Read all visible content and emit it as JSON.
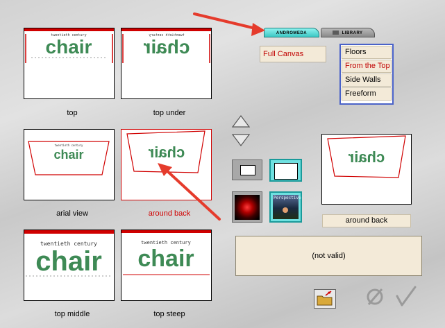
{
  "tabs": [
    {
      "label": "ANDROMEDA",
      "active": true
    },
    {
      "label": "LIBRARY",
      "active": false
    }
  ],
  "mode_field": {
    "value": "Full Canvas"
  },
  "view_list": {
    "items": [
      "Floors",
      "From the Top",
      "Side Walls",
      "Freeform"
    ],
    "selected": "From the Top"
  },
  "presets": [
    {
      "caption": "top",
      "thumb_text": "chair",
      "selected": false
    },
    {
      "caption": "top under",
      "thumb_text": "chair",
      "selected": false
    },
    {
      "caption": "arial view",
      "thumb_text": "chair",
      "selected": false
    },
    {
      "caption": "around back",
      "thumb_text": "chair",
      "selected": true
    },
    {
      "caption": "top middle",
      "thumb_text": "chair",
      "selected": false
    },
    {
      "caption": "top steep",
      "thumb_text": "chair",
      "selected": false
    }
  ],
  "thumb_subtitle": "twentieth century",
  "tools": {
    "perspective_label": "Perspective"
  },
  "preview": {
    "caption": "around back",
    "thumb_text": "chair"
  },
  "status": {
    "text": "(not valid)"
  },
  "colors": {
    "accent_red": "#d00000",
    "list_border": "#4a62c8",
    "thumb_green": "#3e8a55",
    "annotation_red": "#e53b2c"
  },
  "icons": [
    "scroll-up-icon",
    "scroll-down-icon",
    "small-frame-icon",
    "large-frame-icon",
    "nebula-image-icon",
    "perspective-image-icon",
    "open-folder-icon",
    "cancel-icon",
    "ok-check-icon"
  ]
}
